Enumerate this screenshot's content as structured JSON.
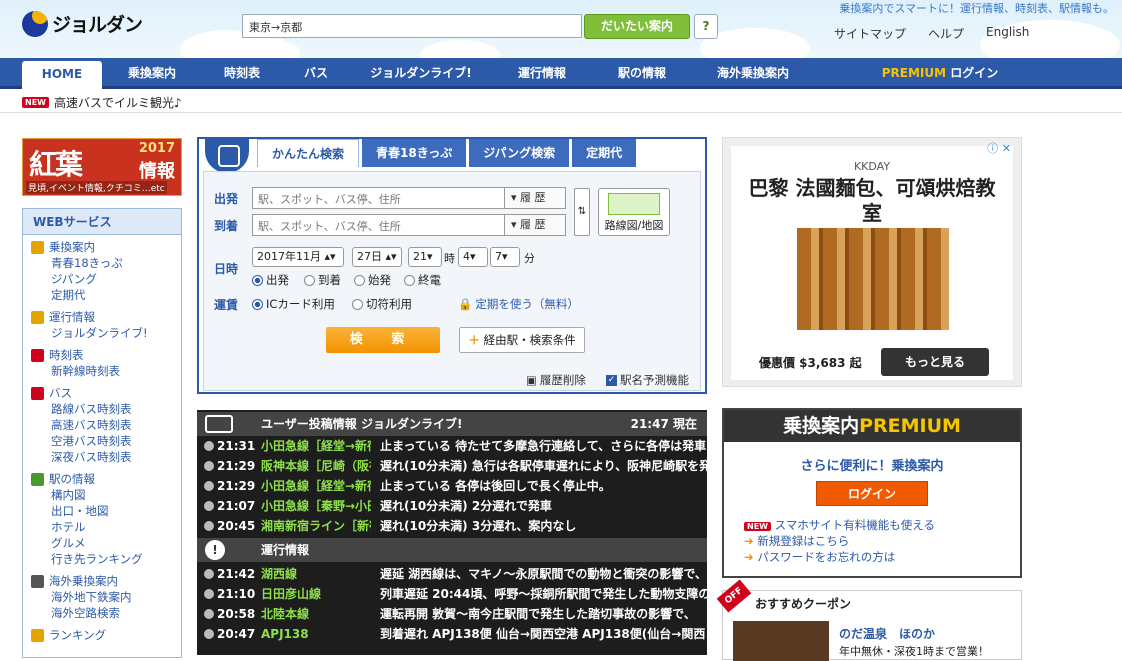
{
  "header": {
    "logo_text": "ジョルダン",
    "search_value": "東京→京都",
    "search_button": "だいたい案内",
    "help_q": "?",
    "tagline": "乗換案内でスマートに！運行情報、時刻表、駅情報も。",
    "links": [
      "サイトマップ",
      "ヘルプ",
      "English"
    ]
  },
  "nav": {
    "items": [
      "HOME",
      "乗換案内",
      "時刻表",
      "バス",
      "ジョルダンライブ!",
      "運行情報",
      "駅の情報",
      "海外乗換案内"
    ],
    "premium_word": "PREMIUM",
    "premium_login": "ログイン"
  },
  "news": {
    "badge": "NEW",
    "text": "高速バスでイルミ観光♪"
  },
  "banner": {
    "big": "紅葉",
    "year": "2017",
    "jouhou": "情報",
    "sub": "見頃,イベント情報,クチコミ…etc"
  },
  "sidebar": {
    "title": "WEBサービス",
    "groups": [
      {
        "label": "乗換案内",
        "items": [
          "青春18きっぷ",
          "ジパング",
          "定期代"
        ],
        "icon": "train-icon",
        "color": "#e3a400"
      },
      {
        "label": "運行情報",
        "items": [
          "ジョルダンライブ!"
        ],
        "icon": "warning-icon",
        "color": "#e3a400"
      },
      {
        "label": "時刻表",
        "items": [
          "新幹線時刻表"
        ],
        "icon": "clock-icon",
        "color": "#d0021b"
      },
      {
        "label": "バス",
        "items": [
          "路線バス時刻表",
          "高速バス時刻表",
          "空港バス時刻表",
          "深夜バス時刻表"
        ],
        "icon": "bus-clock-icon",
        "color": "#d0021b"
      },
      {
        "label": "駅の情報",
        "items": [
          "構内図",
          "出口・地図",
          "ホテル",
          "グルメ",
          "行き先ランキング"
        ],
        "icon": "station-icon",
        "color": "#4a9a2a"
      },
      {
        "label": "海外乗換案内",
        "items": [
          "海外地下鉄案内",
          "海外空路検索"
        ],
        "icon": "plane-icon",
        "color": "#555"
      },
      {
        "label": "ランキング",
        "items": [],
        "icon": "crown-icon",
        "color": "#e3a400"
      }
    ]
  },
  "search_panel": {
    "tabs": [
      "かんたん検索",
      "青春18きっぷ",
      "ジパング検索",
      "定期代"
    ],
    "from_label": "出発",
    "to_label": "到着",
    "from_placeholder": "駅、スポット、バス停、住所",
    "to_placeholder": "駅、スポット、バス停、住所",
    "history": "履 歴",
    "route_map": "路線図/地図",
    "datetime_label": "日時",
    "month": "2017年11月",
    "day": "27日",
    "hour": "21",
    "hour_unit": "時",
    "min1": "4",
    "min2": "7",
    "min_unit": "分",
    "time_options": [
      "出発",
      "到着",
      "始発",
      "終電"
    ],
    "fare_label": "運賃",
    "fare_options": [
      "ICカード利用",
      "切符利用"
    ],
    "commuter": "定期を使う（無料）",
    "search_button": "検 索",
    "via_button": "経由駅・検索条件",
    "delete_history": "履歴削除",
    "predict": "駅名予測機能"
  },
  "ad": {
    "brand": "KKDAY",
    "title": "巴黎 法國麵包、可頌烘焙教室",
    "price": "優惠價 $3,683 起",
    "cta": "もっと見る"
  },
  "board": {
    "title": "ユーザー投稿情報 ジョルダンライブ!",
    "time": "21:47 現在",
    "posts": [
      {
        "t": "21:31",
        "line": "小田急線［経堂→新宿",
        "msg": "止まっている 待たせて多摩急行連絡して、さらに各停は発車"
      },
      {
        "t": "21:29",
        "line": "阪神本線［尼崎（阪神",
        "msg": "遅れ(10分未満) 急行は各駅停車遅れにより、阪神尼崎駅を発"
      },
      {
        "t": "21:29",
        "line": "小田急線［経堂→新宿",
        "msg": "止まっている 各停は後回しで長く停止中。"
      },
      {
        "t": "21:07",
        "line": "小田急線［秦野→小田",
        "msg": "遅れ(10分未満) 2分遅れで発車"
      },
      {
        "t": "20:45",
        "line": "湘南新宿ライン［新宿",
        "msg": "遅れ(10分未満) 3分遅れ、案内なし"
      }
    ],
    "ops_title": "運行情報",
    "ops": [
      {
        "t": "21:42",
        "line": "湖西線",
        "msg": "遅延 湖西線は、マキノ～永原駅間での動物と衝突の影響で、"
      },
      {
        "t": "21:10",
        "line": "日田彦山線",
        "msg": "列車遅延 20:44頃、呼野～採銅所駅間で発生した動物支障の"
      },
      {
        "t": "20:58",
        "line": "北陸本線",
        "msg": "運転再開 敦賀～南今庄駅間で発生した踏切事故の影響で、"
      },
      {
        "t": "20:47",
        "line": "APJ138",
        "msg": "到着遅れ APJ138便 仙台→関西空港 APJ138便(仙台→関西"
      }
    ]
  },
  "premium": {
    "title_a": "乗換案内",
    "title_b": "PREMIUM",
    "lead": "さらに便利に！乗換案内",
    "login": "ログイン",
    "links": [
      "スマホサイト有料機能も使える",
      "新規登録はこちら",
      "パスワードをお忘れの方は"
    ],
    "new_badge": "NEW"
  },
  "coupon": {
    "off": "OFF",
    "title": "おすすめクーポン",
    "shop": "のだ温泉　ほのか",
    "desc": "年中無休・深夜1時まで営業！"
  }
}
